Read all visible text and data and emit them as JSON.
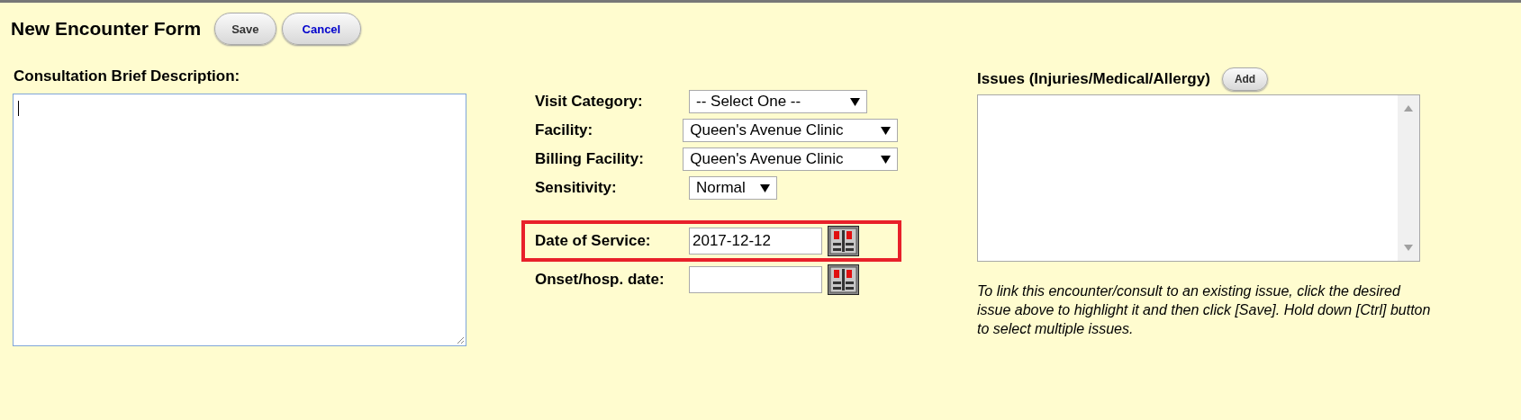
{
  "header": {
    "title": "New Encounter Form",
    "buttons": [
      {
        "label": "Save",
        "kind": "primary"
      },
      {
        "label": "Cancel",
        "kind": "link"
      }
    ]
  },
  "description": {
    "label": "Consultation Brief Description:"
  },
  "fields": [
    {
      "label": "Visit Category:",
      "kind": "select",
      "value": "-- Select One --",
      "highlighted": false
    },
    {
      "label": "Facility:",
      "kind": "select",
      "value": "Queen's Avenue Clinic",
      "highlighted": false
    },
    {
      "label": "Billing Facility:",
      "kind": "select",
      "value": "Queen's Avenue Clinic",
      "highlighted": false
    },
    {
      "label": "Sensitivity:",
      "kind": "select",
      "value": "Normal",
      "highlighted": false
    },
    {
      "label": "Date of Service:",
      "kind": "date",
      "value": "2017-12-12",
      "highlighted": true
    },
    {
      "label": "Onset/hosp. date:",
      "kind": "date",
      "highlighted": false
    }
  ],
  "issues": {
    "label": "Issues (Injuries/Medical/Allergy)",
    "add_button": "Add",
    "help": "To link this encounter/consult to an existing issue, click the desired issue above to highlight it and then click [Save]. Hold down [Ctrl] button to select multiple issues."
  }
}
